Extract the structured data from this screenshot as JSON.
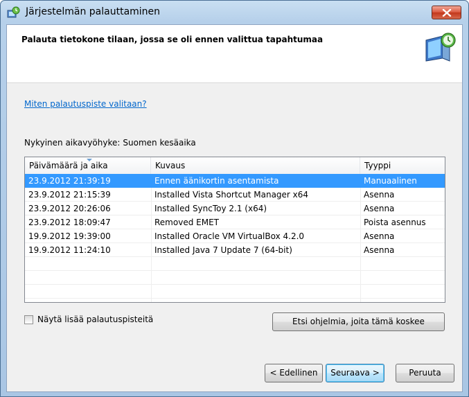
{
  "window": {
    "title": "Järjestelmän palauttaminen",
    "icon": "system-restore-icon",
    "close_icon": "close-icon"
  },
  "header": {
    "title": "Palauta tietokone tilaan, jossa se oli ennen valittua tapahtumaa",
    "icon": "system-restore-monitor-icon"
  },
  "help_link": "Miten palautuspiste valitaan?",
  "timezone": {
    "label": "Nykyinen aikavyöhyke:",
    "value": "Suomen kesäaika"
  },
  "table": {
    "columns": [
      "Päivämäärä ja aika",
      "Kuvaus",
      "Tyyppi"
    ],
    "sort_column": 0,
    "rows": [
      {
        "date": "23.9.2012 21:39:19",
        "description": "Ennen äänikortin asentamista",
        "type": "Manuaalinen",
        "selected": true
      },
      {
        "date": "23.9.2012 21:15:39",
        "description": "Installed Vista Shortcut Manager x64",
        "type": "Asenna",
        "selected": false
      },
      {
        "date": "23.9.2012 20:26:06",
        "description": "Installed SyncToy 2.1 (x64)",
        "type": "Asenna",
        "selected": false
      },
      {
        "date": "23.9.2012 18:09:47",
        "description": "Removed EMET",
        "type": "Poista asennus",
        "selected": false
      },
      {
        "date": "19.9.2012 19:39:00",
        "description": "Installed Oracle VM VirtualBox 4.2.0",
        "type": "Asenna",
        "selected": false
      },
      {
        "date": "19.9.2012 11:24:10",
        "description": "Installed Java 7 Update 7 (64-bit)",
        "type": "Asenna",
        "selected": false
      }
    ]
  },
  "show_more": {
    "label": "Näytä lisää palautuspisteitä",
    "checked": false
  },
  "buttons": {
    "search": "Etsi ohjelmia, joita tämä koskee",
    "previous": "< Edellinen",
    "next": "Seuraava >",
    "cancel": "Peruuta"
  },
  "colors": {
    "selection": "#3399ff",
    "link": "#0066cc"
  }
}
